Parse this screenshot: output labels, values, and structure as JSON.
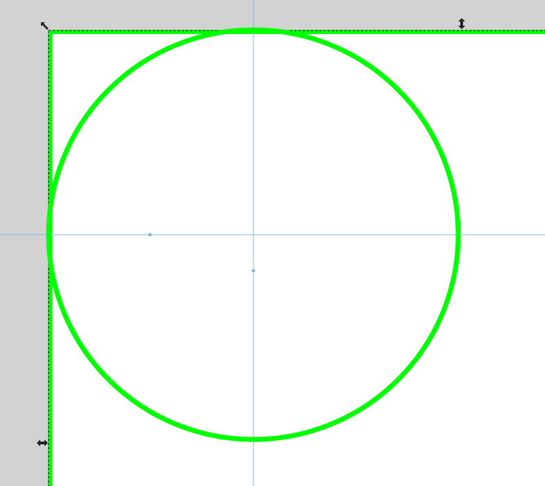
{
  "canvas": {
    "background": "#d2d2d2",
    "page_color": "#ffffff"
  },
  "selection": {
    "outline_color": "#00ff00",
    "dash_color": "#000000",
    "handles": [
      {
        "name": "resize-nw-handle",
        "icon": "diagonal-resize-arrow-icon"
      },
      {
        "name": "resize-n-handle",
        "icon": "vertical-resize-arrow-icon"
      },
      {
        "name": "resize-w-handle",
        "icon": "horizontal-resize-arrow-icon"
      }
    ]
  },
  "shape": {
    "type": "circle",
    "stroke": "#00ff00"
  },
  "guides": {
    "color": "#7fb7e0"
  }
}
